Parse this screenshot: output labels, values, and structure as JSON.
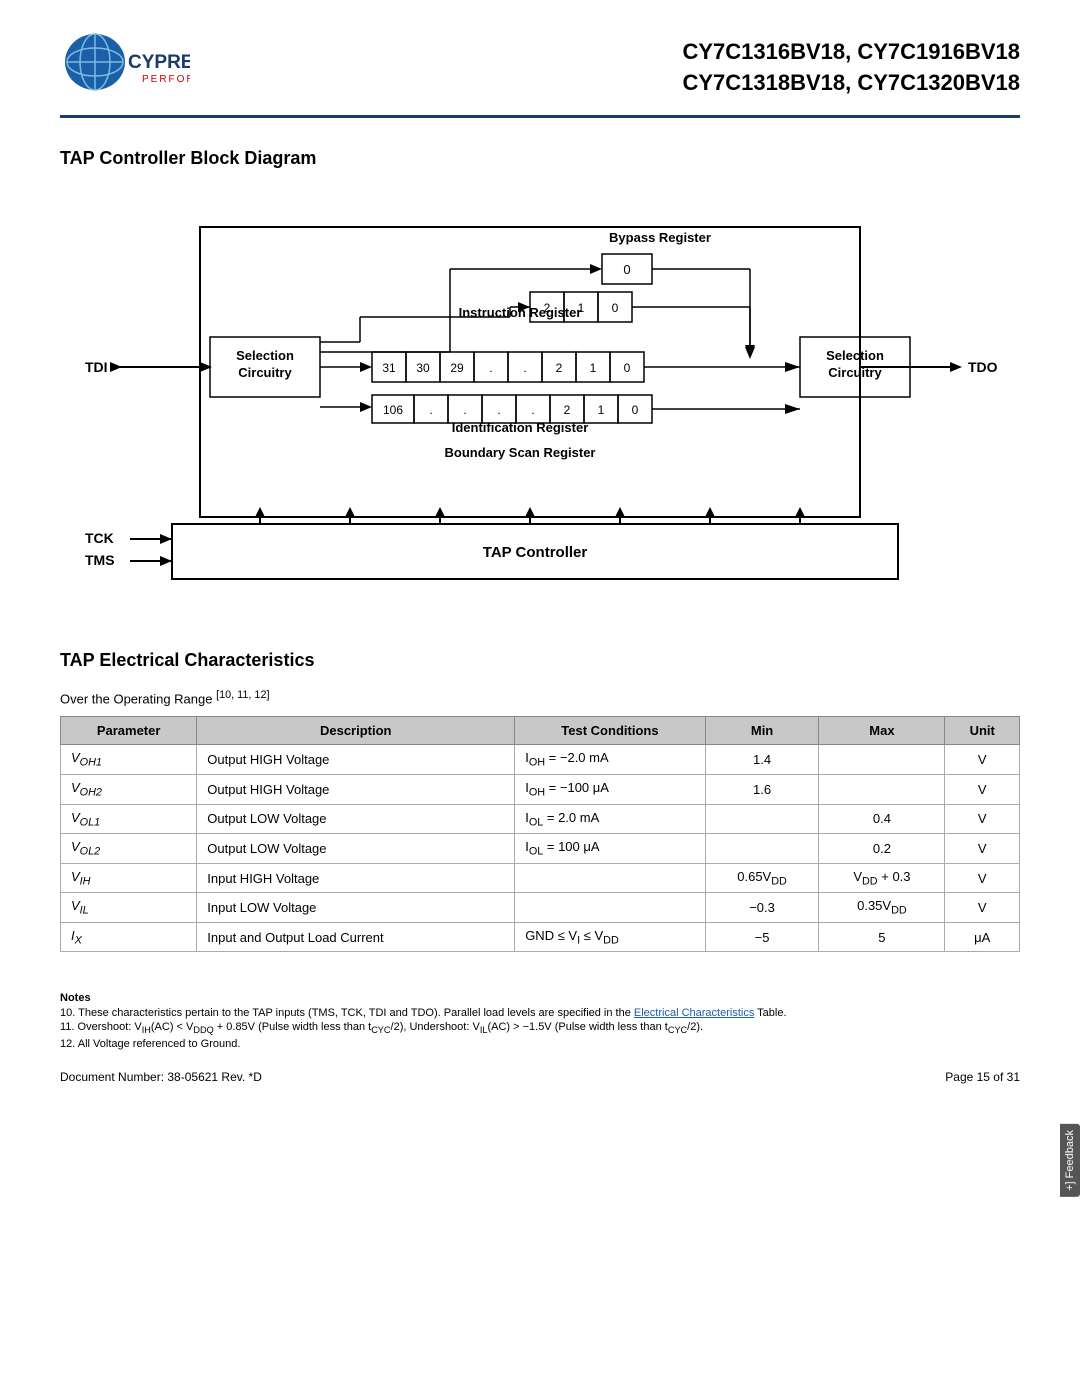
{
  "header": {
    "title_line1": "CY7C1316BV18, CY7C1916BV18",
    "title_line2": "CY7C1318BV18, CY7C1320BV18",
    "logo_cypress": "CYPRESS",
    "logo_perform": "PERFORM"
  },
  "diagram_section": {
    "title": "TAP Controller Block Diagram",
    "labels": {
      "tdi": "TDI",
      "tdo": "TDO",
      "tck": "TCK",
      "tms": "TMS",
      "selection_circuitry_left": "Selection\nCircuitry",
      "selection_circuitry_right": "Selection\nCircuitry",
      "bypass_register": "Bypass Register",
      "instruction_register": "Instruction Register",
      "identification_register": "Identification Register",
      "boundary_scan_register": "Boundary Scan Register",
      "tap_controller": "TAP Controller"
    }
  },
  "elec_section": {
    "title": "TAP Electrical Characteristics",
    "subtitle": "Over the Operating Range [10, 11, 12]",
    "table_headers": [
      "Parameter",
      "Description",
      "Test Conditions",
      "Min",
      "Max",
      "Unit"
    ],
    "rows": [
      {
        "param": "V₀H₁",
        "param_html": "V<sub>OH1</sub>",
        "description": "Output HIGH Voltage",
        "test_conditions": "I₀H = −2.0 mA",
        "test_html": "I<sub>OH</sub> = −2.0 mA",
        "min": "1.4",
        "max": "",
        "unit": "V"
      },
      {
        "param": "V₀H₂",
        "param_html": "V<sub>OH2</sub>",
        "description": "Output HIGH Voltage",
        "test_conditions": "I₀H = −100 μA",
        "test_html": "I<sub>OH</sub> = −100 μA",
        "min": "1.6",
        "max": "",
        "unit": "V"
      },
      {
        "param": "V₀L₁",
        "param_html": "V<sub>OL1</sub>",
        "description": "Output LOW Voltage",
        "test_conditions": "I₀L = 2.0 mA",
        "test_html": "I<sub>OL</sub> = 2.0 mA",
        "min": "",
        "max": "0.4",
        "unit": "V"
      },
      {
        "param": "V₀L₂",
        "param_html": "V<sub>OL2</sub>",
        "description": "Output LOW Voltage",
        "test_conditions": "I₀L = 100 μA",
        "test_html": "I<sub>OL</sub> = 100 μA",
        "min": "",
        "max": "0.2",
        "unit": "V"
      },
      {
        "param": "VᴵH",
        "param_html": "V<sub>IH</sub>",
        "description": "Input HIGH Voltage",
        "test_conditions": "",
        "min": "0.65Vᴵᴵ",
        "min_html": "0.65V<sub>DD</sub>",
        "max": "Vᴵᴵ + 0.3",
        "max_html": "V<sub>DD</sub> + 0.3",
        "unit": "V"
      },
      {
        "param": "VᴵL",
        "param_html": "V<sub>IL</sub>",
        "description": "Input LOW Voltage",
        "test_conditions": "",
        "min": "−0.3",
        "max": "0.35Vᴵᴵ",
        "max_html": "0.35V<sub>DD</sub>",
        "unit": "V"
      },
      {
        "param": "Iₓ",
        "param_html": "I<sub>X</sub>",
        "description": "Input and Output Load Current",
        "test_conditions": "GND ≤ Vᴵ ≤ Vᴵᴵ",
        "test_html": "GND ≤ V<sub>I</sub> ≤ V<sub>DD</sub>",
        "min": "−5",
        "max": "5",
        "unit": "μA"
      }
    ]
  },
  "notes": {
    "title": "Notes",
    "items": [
      "10. These characteristics pertain to the TAP inputs (TMS, TCK, TDI and TDO). Parallel load levels are specified in the Electrical Characteristics Table.",
      "11. Overshoot: VᴵH(AC) < Vᴵᴵᴵ + 0.85V (Pulse width less than tᴄYᴄ/2), Undershoot: VᴵL(AC) > −1.5V (Pulse width less than tᴄYᴄ/2).",
      "12. All Voltage referenced to Ground."
    ]
  },
  "footer": {
    "doc_number": "Document Number: 38-05621 Rev. *D",
    "page": "Page 15 of 31"
  },
  "feedback_label": "+] Feedback"
}
